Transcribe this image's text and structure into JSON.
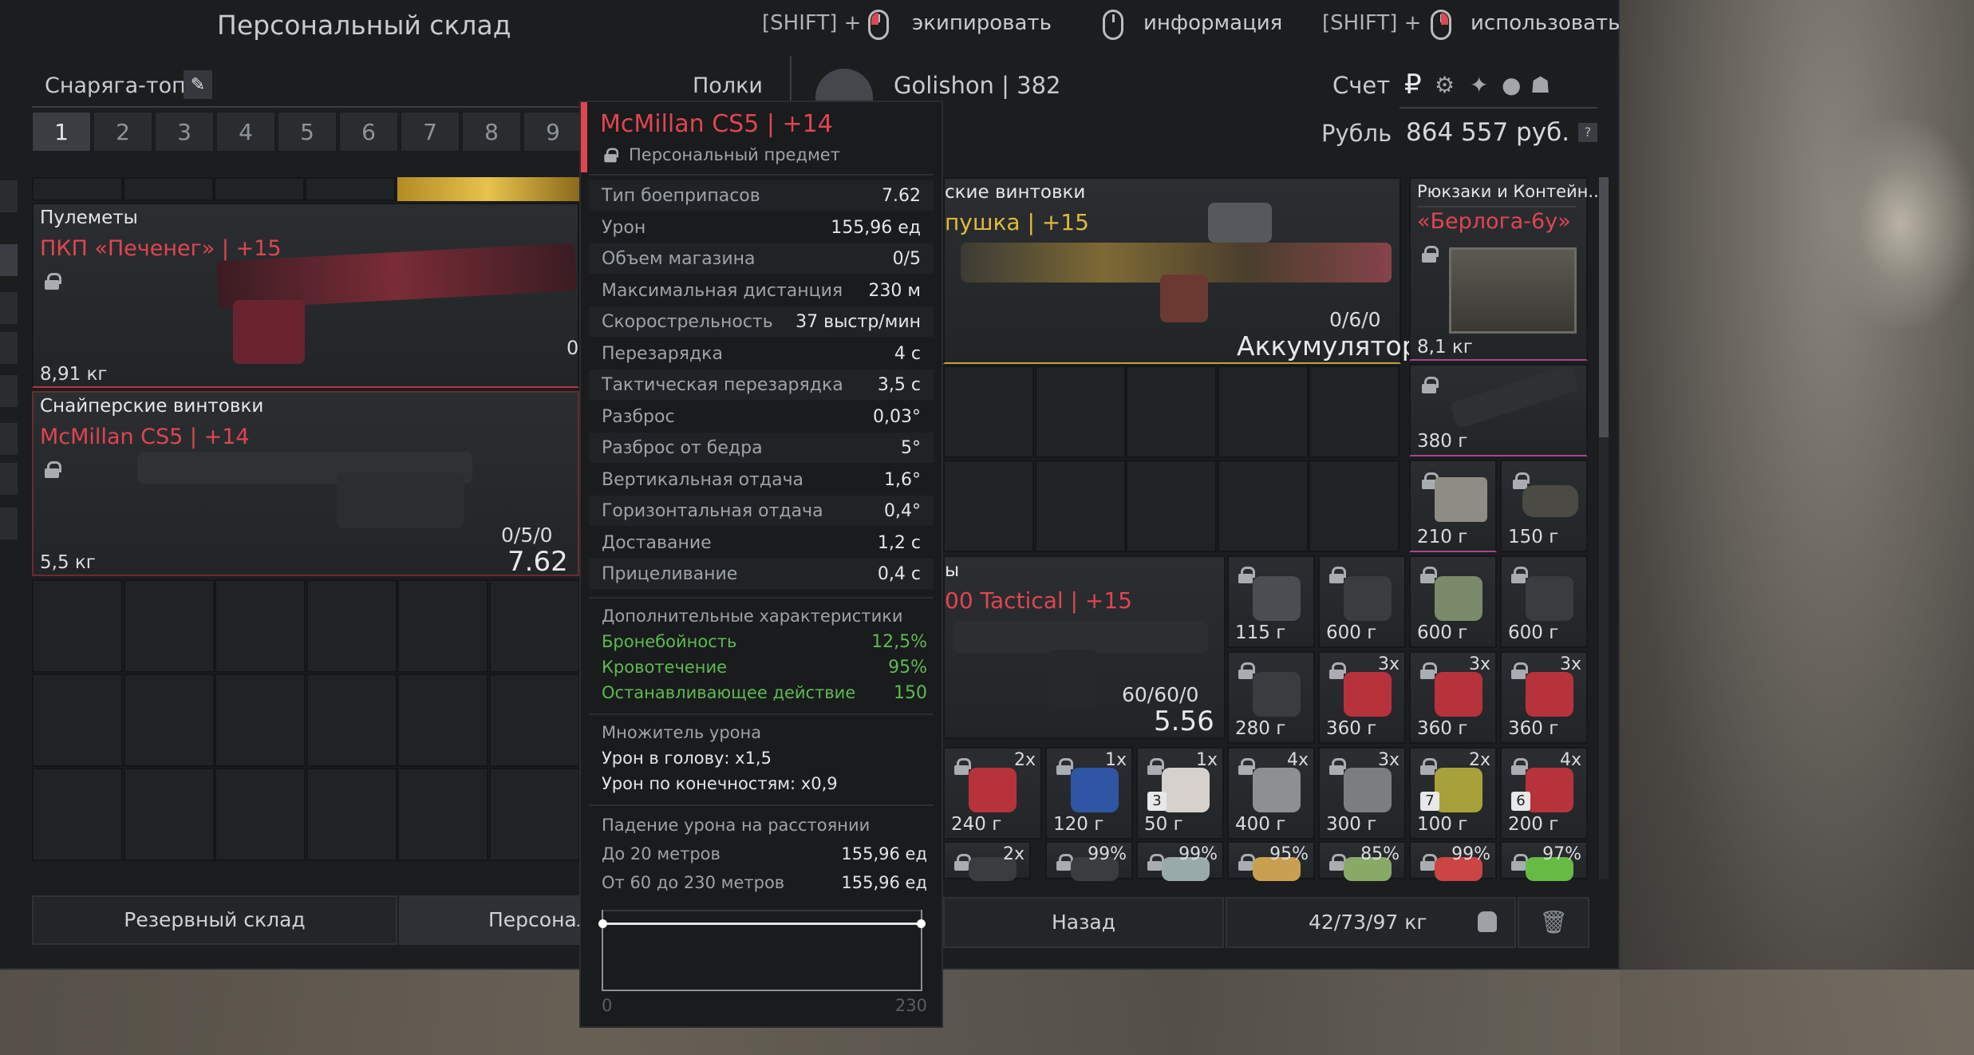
{
  "header": {
    "title": "Персональный склад",
    "hint_equip_prefix": "[SHIFT] +",
    "hint_equip": "экипировать",
    "hint_info": "информация",
    "hint_use_prefix": "[SHIFT] +",
    "hint_use": "использовать"
  },
  "left": {
    "preset_name": "Снаряга-топ",
    "shelves_label": "Полки",
    "tabs": [
      "1",
      "2",
      "3",
      "4",
      "5",
      "6",
      "7",
      "8",
      "9"
    ],
    "active_tab": "1",
    "items": [
      {
        "category": "Пулеметы",
        "name": "ПКП «Печенег» | +15",
        "weight": "8,91 кг",
        "ammo_partial": "0"
      },
      {
        "category": "Снайперские винтовки",
        "name": "McMillan CS5 | +14",
        "weight": "5,5 кг",
        "ammo": "0/5/0",
        "caliber": "7.62"
      }
    ],
    "reserve_button": "Резервный склад",
    "personal_button": "Персональ"
  },
  "right": {
    "player_name": "Golishon | 382",
    "account_label": "Счет",
    "currency_label": "Рубль",
    "balance": "864 557 руб.",
    "help": "?",
    "weapon_category": "ские винтовки",
    "weapon_name": "пушка | +15",
    "weapon_ammo": "0/6/0",
    "weapon_ammo_type": "Аккумулятор",
    "backpack_category": "Рюкзаки и Контейн..",
    "backpack_name": "«Берлога-6у»",
    "backpack_weight": "8,1 кг",
    "scope_weight": "380 г",
    "det1_weight": "210 г",
    "det2_weight": "150 г",
    "rifle2_category": "ы",
    "rifle2_name": "00 Tactical | +15",
    "rifle2_ammo": "60/60/0",
    "rifle2_caliber": "5.56",
    "small": [
      {
        "w": "115 г"
      },
      {
        "w": "600 г"
      },
      {
        "w": "600 г"
      },
      {
        "w": "600 г"
      },
      {
        "w": "280 г"
      },
      {
        "w": "360 г",
        "c": "3x"
      },
      {
        "w": "360 г",
        "c": "3x"
      },
      {
        "w": "360 г",
        "c": "3x"
      },
      {
        "w": "240 г",
        "c": "2x"
      },
      {
        "w": "120 г",
        "c": "1x"
      },
      {
        "w": "50 г",
        "c": "1x",
        "n": "3"
      },
      {
        "w": "400 г",
        "c": "4x"
      },
      {
        "w": "300 г",
        "c": "3x"
      },
      {
        "w": "100 г",
        "c": "2x",
        "n": "7"
      },
      {
        "w": "200 г",
        "c": "4x",
        "n": "6"
      },
      {
        "c": "2x"
      },
      {
        "c": "99%"
      },
      {
        "c": "99%"
      },
      {
        "c": "95%"
      },
      {
        "c": "85%"
      },
      {
        "c": "99%"
      },
      {
        "c": "97%"
      }
    ],
    "back_button": "Назад",
    "weight_total": "42/73/97 кг"
  },
  "tooltip": {
    "name": "McMillan CS5 | +14",
    "subtitle": "Персональный предмет",
    "stats": [
      {
        "k": "Тип боеприпасов",
        "v": "7.62"
      },
      {
        "k": "Урон",
        "v": "155,96 ед"
      },
      {
        "k": "Объем магазина",
        "v": "0/5"
      },
      {
        "k": "Максимальная дистанция",
        "v": "230 м"
      },
      {
        "k": "Скорострельность",
        "v": "37 выстр/мин"
      },
      {
        "k": "Перезарядка",
        "v": "4 с"
      },
      {
        "k": "Тактическая перезарядка",
        "v": "3,5 с"
      },
      {
        "k": "Разброс",
        "v": "0,03°"
      },
      {
        "k": "Разброс от бедра",
        "v": "5°"
      },
      {
        "k": "Вертикальная отдача",
        "v": "1,6°"
      },
      {
        "k": "Горизонтальная отдача",
        "v": "0,4°"
      },
      {
        "k": "Доставание",
        "v": "1,2 с"
      },
      {
        "k": "Прицеливание",
        "v": "0,4 с"
      }
    ],
    "extra_title": "Дополнительные характеристики",
    "extra": [
      {
        "k": "Бронебойность",
        "v": "12,5%"
      },
      {
        "k": "Кровотечение",
        "v": "95%"
      },
      {
        "k": "Останавливающее действие",
        "v": "150"
      }
    ],
    "mult_title": "Множитель урона",
    "mult_head": "Урон в голову: x1,5",
    "mult_limbs": "Урон по конечностям: x0,9",
    "falloff_title": "Падение урона на расстоянии",
    "falloff": [
      {
        "k": "До 20 метров",
        "v": "155,96 ед"
      },
      {
        "k": "От 60 до 230 метров",
        "v": "155,96 ед"
      }
    ],
    "chart_min": "0",
    "chart_max": "230"
  },
  "colors": {
    "accent_red": "#e04550",
    "rarity_gold": "#e2b93b",
    "panel": "#1b1d1f",
    "green": "#5cbb4c"
  }
}
